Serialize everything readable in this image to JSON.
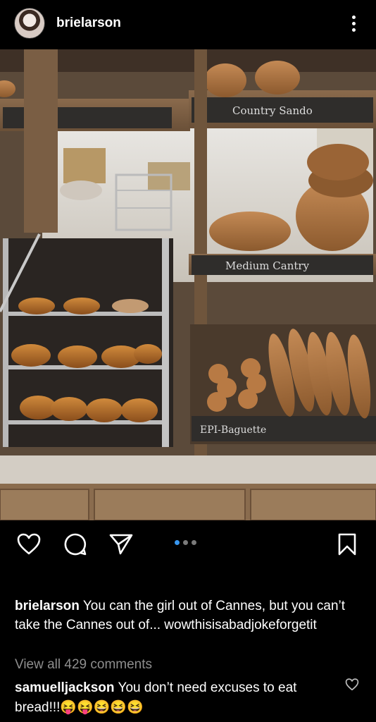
{
  "header": {
    "username": "brielarson",
    "avatar_icon": "profile-avatar",
    "more_icon": "more-vertical-icon"
  },
  "post": {
    "image_signs": {
      "top": "Country Sando",
      "middle": "Medium Cantry",
      "bottom": "EPI-Baguette"
    }
  },
  "actions": {
    "like_icon": "heart-icon",
    "comment_icon": "comment-icon",
    "share_icon": "send-icon",
    "save_icon": "bookmark-icon",
    "carousel": {
      "count": 3,
      "active": 1
    }
  },
  "caption": {
    "username": "brielarson",
    "text": "You can the girl out of Cannes, but you can’t take the Cannes out of... wowthisisabadjokeforgetit"
  },
  "view_comments": "View all 429 comments",
  "comment": {
    "username": "samuelljackson",
    "text": "You don’t need excuses to eat bread!!!😝😝😆😆😆"
  },
  "colors": {
    "background": "#000000",
    "text": "#ffffff",
    "muted": "#8e8e8e",
    "accent": "#3897f0"
  }
}
